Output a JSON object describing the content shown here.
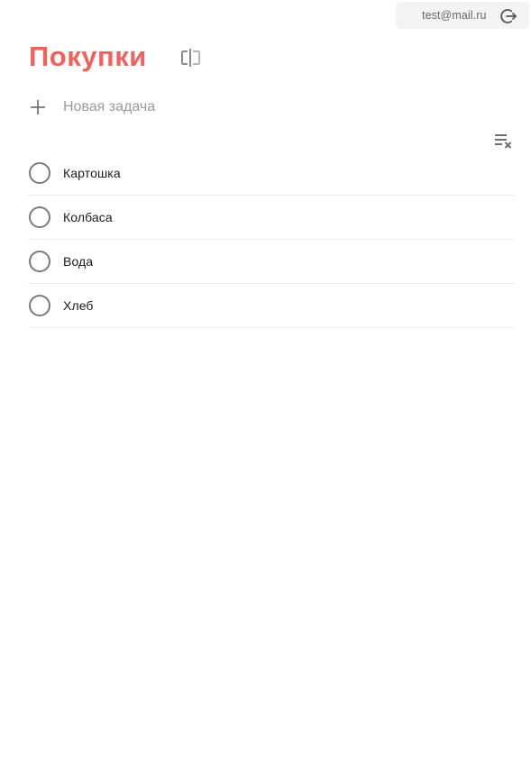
{
  "account": {
    "email": "test@mail.ru",
    "logout_icon": "logout-icon"
  },
  "list": {
    "title": "Покупки",
    "rename_icon": "rename-icon",
    "title_color": "#f0625d"
  },
  "new_task": {
    "placeholder": "Новая задача",
    "add_icon": "plus-icon"
  },
  "toolbar": {
    "clear_completed_icon": "clear-list-icon"
  },
  "tasks": [
    {
      "label": "Картошка",
      "done": false
    },
    {
      "label": "Колбаса",
      "done": false
    },
    {
      "label": "Вода",
      "done": false
    },
    {
      "label": "Хлеб",
      "done": false
    }
  ]
}
